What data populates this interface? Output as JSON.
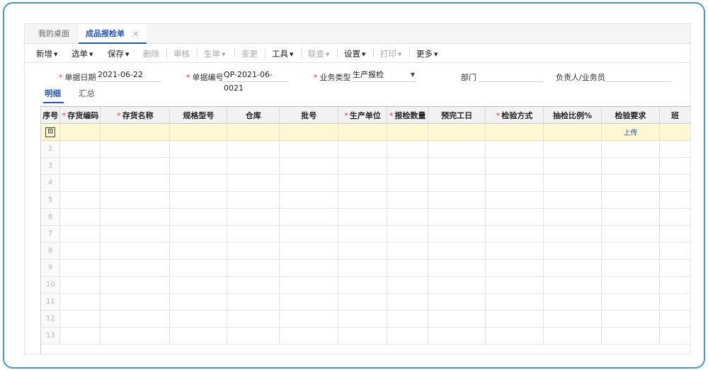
{
  "tabs": {
    "desktop": "我的桌面",
    "active": "成品报检单",
    "close": "×"
  },
  "toolbar": {
    "new": "新增",
    "select": "选单",
    "save": "保存",
    "delete": "删除",
    "audit": "审核",
    "generate": "生单",
    "change": "变更",
    "tools": "工具",
    "linked_query": "联查",
    "settings": "设置",
    "print": "打印",
    "more": "更多"
  },
  "form": {
    "doc_date_label": "单据日期",
    "doc_date_value": "2021-06-22",
    "doc_no_label": "单据编号",
    "doc_no_value": "QP-2021-06-0021",
    "biz_type_label": "业务类型",
    "biz_type_value": "生产报检",
    "dept_label": "部门",
    "dept_value": "",
    "owner_label": "负责人/业务员",
    "owner_value": "",
    "required_mark": "*"
  },
  "subtabs": {
    "detail": "明细",
    "summary": "汇总"
  },
  "grid": {
    "columns": [
      {
        "label": "序号",
        "required": false
      },
      {
        "label": "存货编码",
        "required": true
      },
      {
        "label": "存货名称",
        "required": true
      },
      {
        "label": "规格型号",
        "required": false
      },
      {
        "label": "仓库",
        "required": false
      },
      {
        "label": "批号",
        "required": false
      },
      {
        "label": "生产单位",
        "required": true
      },
      {
        "label": "报检数量",
        "required": true
      },
      {
        "label": "预完工日",
        "required": false
      },
      {
        "label": "检验方式",
        "required": true
      },
      {
        "label": "抽检比例%",
        "required": false
      },
      {
        "label": "检验要求",
        "required": false
      },
      {
        "label": "班",
        "required": false
      }
    ],
    "first_row_icon": "row-edit-icon",
    "first_row_icon_glyph": "⊡",
    "upload_label": "上传",
    "row_numbers": [
      "2",
      "3",
      "4",
      "5",
      "6",
      "7",
      "8",
      "9",
      "10",
      "11",
      "12",
      "13"
    ]
  },
  "colors": {
    "accent": "#1f56c4",
    "frame": "#3f95e6",
    "required": "#e23c3c",
    "active_row": "#fdf8d2"
  }
}
